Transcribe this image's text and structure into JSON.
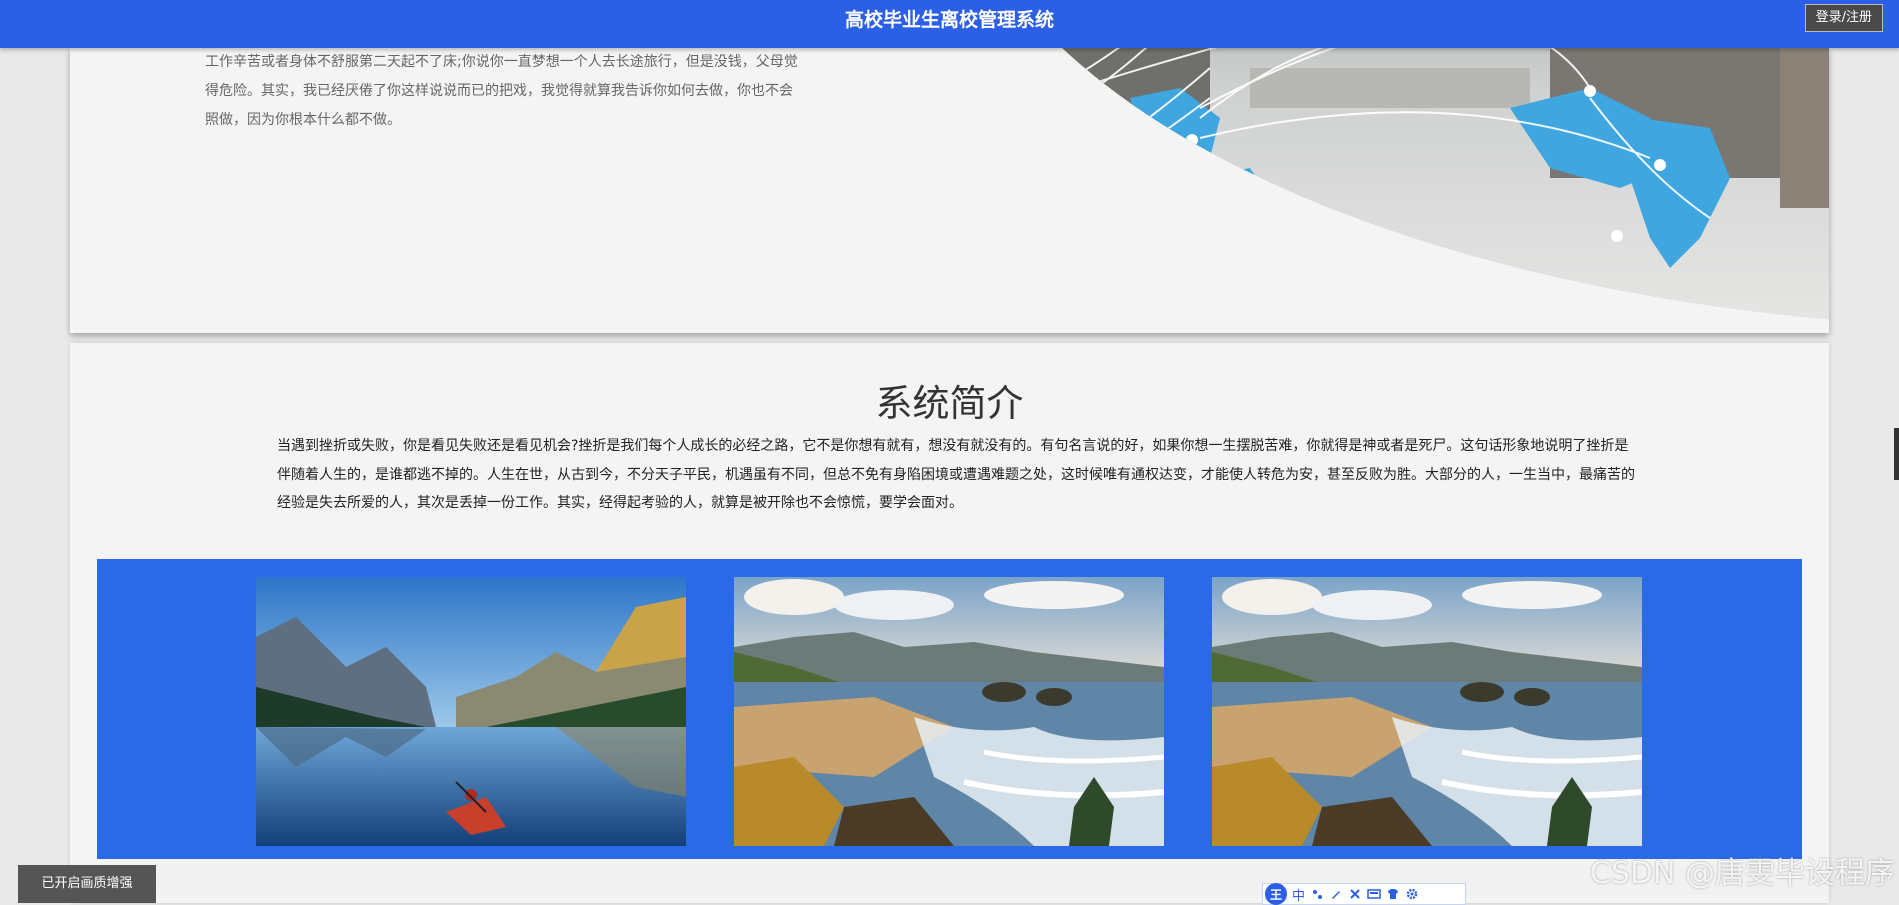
{
  "header": {
    "title": "高校毕业生离校管理系统",
    "login_label": "登录/注册"
  },
  "about": {
    "paragraphs": [
      "工作辛苦或者身体不舒服第二天起不了床;你说你一直梦想一个人去长途旅行，但是没钱，父母觉",
      "得危险。其实，我已经厌倦了你这样说说而已的把戏，我觉得就算我告诉你如何去做，你也不会",
      "照做，因为你根本什么都不做。"
    ]
  },
  "intro": {
    "title": "系统简介",
    "lines": [
      "当遇到挫折或失败，你是看见失败还是看见机会?挫折是我们每个人成长的必经之路，它不是你想有就有，想没有就没有的。有句名言说的好，如果你想一生摆脱苦难，你就得是神或者是死尸。这句话形象地说明了挫折是",
      "伴随着人生的，是谁都逃不掉的。人生在世，从古到今，不分天子平民，机遇虽有不同，但总不免有身陷困境或遭遇难题之处，这时候唯有通权达变，才能使人转危为安，甚至反败为胜。大部分的人，一生当中，最痛苦的",
      "经验是失去所爱的人，其次是丢掉一份工作。其实，经得起考验的人，就算是被开除也不会惊慌，要学会面对。"
    ]
  },
  "gallery": {
    "photos": [
      "lake-kayak-photo",
      "coast-beach-photo",
      "coast-beach-photo"
    ]
  },
  "overlay": {
    "toast": "已开启画质增强",
    "watermark": "CSDN @唐雯毕设程序",
    "ime_logo": "王",
    "ime_mode": "中"
  },
  "colors": {
    "header_bg": "#2a5fe6",
    "gallery_bg": "#2a6ae6",
    "page_bg": "#f4f4f4"
  }
}
